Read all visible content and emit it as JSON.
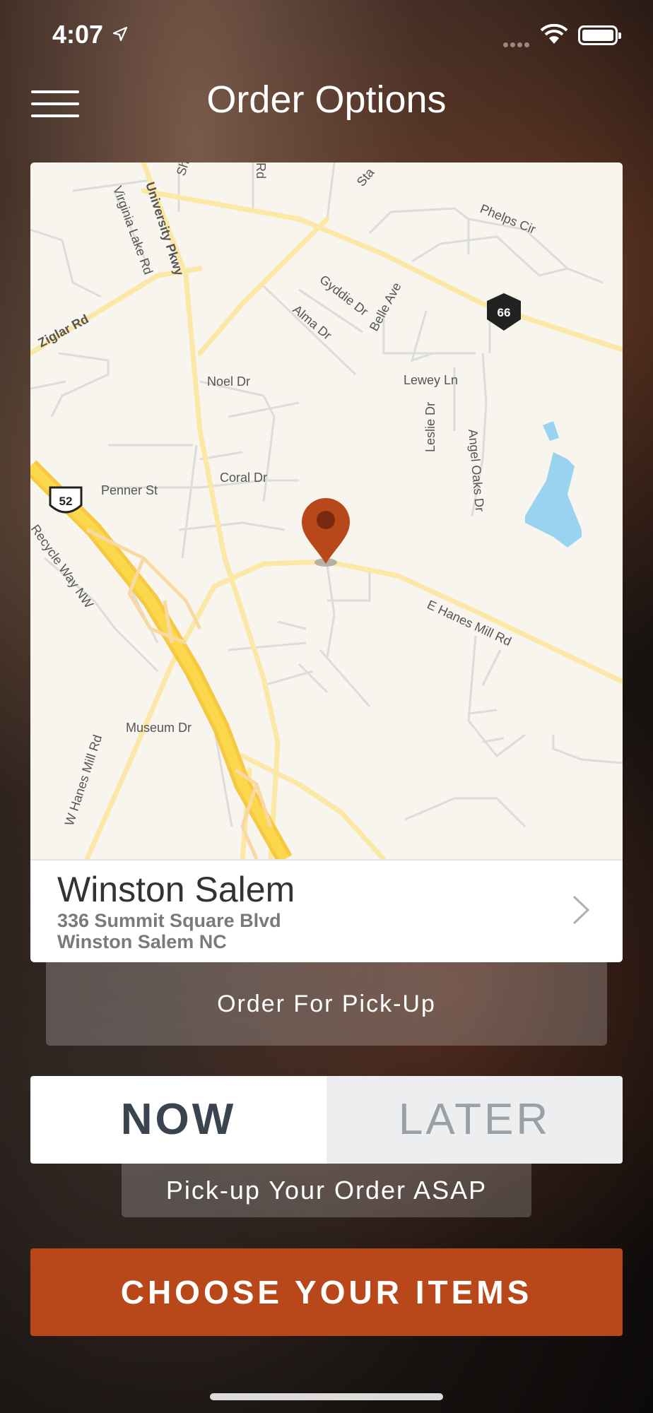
{
  "status_bar": {
    "time": "4:07",
    "icons": [
      "location-arrow-icon",
      "signal-icon",
      "wifi-icon",
      "battery-icon"
    ]
  },
  "header": {
    "title": "Order Options",
    "menu_icon": "hamburger-menu-icon"
  },
  "map": {
    "labels": {
      "university_pkwy": "University Pkwy",
      "virginia_lake_rd": "Virginia Lake Rd",
      "ziglar_rd": "Ziglar Rd",
      "phelps_cir": "Phelps Cir",
      "gyddie_dr": "Gyddie Dr",
      "belle_ave": "Belle Ave",
      "alma_dr": "Alma Dr",
      "noel_dr": "Noel Dr",
      "lewey_ln": "Lewey Ln",
      "leslie_dr": "Leslie Dr",
      "angel_oaks_dr": "Angel Oaks Dr",
      "coral_dr": "Coral Dr",
      "penner_st": "Penner St",
      "recycle_way": "Recycle Way NW",
      "e_hanes_mill": "E Hanes Mill Rd",
      "museum_dr": "Museum Dr",
      "w_hanes_mill": "W Hanes Mill Rd",
      "shield_52": "52",
      "shield_66": "66",
      "sh_partial": "Sh",
      "rd_partial": "Rd",
      "sta_partial": "Sta"
    },
    "pin_color": "#b8481a"
  },
  "store": {
    "name": "Winston Salem",
    "address_line1": "336 Summit Square Blvd",
    "address_line2": "Winston Salem NC"
  },
  "order_type": {
    "label": "Order For Pick-Up"
  },
  "timing": {
    "now_label": "NOW",
    "later_label": "LATER",
    "selected": "NOW",
    "description": "Pick-up Your Order ASAP"
  },
  "cta": {
    "label": "CHOOSE YOUR ITEMS",
    "color": "#b8481a"
  }
}
